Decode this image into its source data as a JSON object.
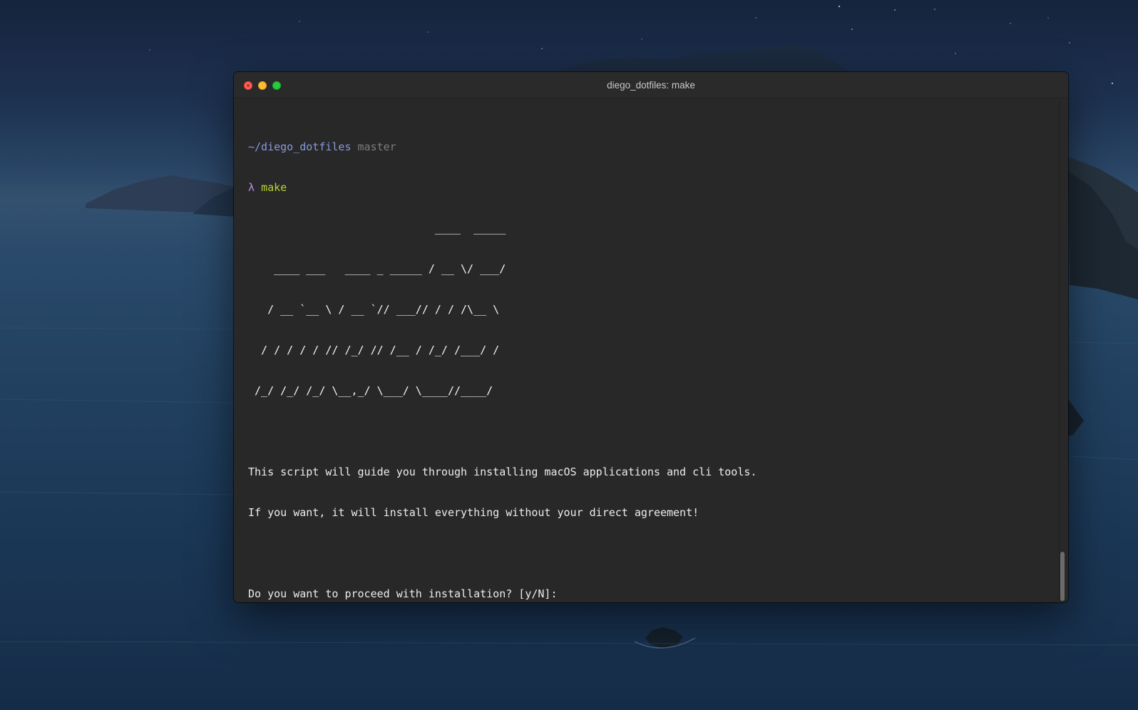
{
  "window": {
    "title": "diego_dotfiles: make"
  },
  "prompt": {
    "path": "~/diego_dotfiles",
    "branch": "master",
    "symbol": "λ",
    "command": "make"
  },
  "banner": {
    "lines": [
      "                             ____  _____",
      "    ____ ___   ____ _ _____ / __ \\/ ___/",
      "   / __ `__ \\ / __ `// ___// / / /\\__ \\",
      "  / / / / / // /_/ // /__ / /_/ /___/ /",
      " /_/ /_/ /_/ \\__,_/ \\___/ \\____//____/"
    ]
  },
  "output": {
    "line1": "This script will guide you through installing macOS applications and cli tools.",
    "line2": "If you want, it will install everything without your direct agreement!",
    "question": "Do you want to proceed with installation? [y/N]:"
  },
  "colors": {
    "terminal_bg": "#282828",
    "path": "#8899dc",
    "branch": "#7d7d7d",
    "lambda": "#b794e8",
    "command": "#b5d334"
  }
}
